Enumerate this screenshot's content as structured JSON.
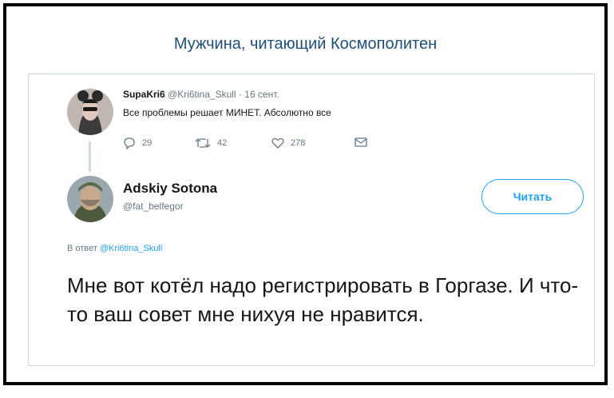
{
  "meme_title": "Мужчина, читающий Космополитен",
  "tweet_original": {
    "author_name": "SupaKri6",
    "handle": "@Kri6tina_Skull",
    "separator": "·",
    "date": "16 сент.",
    "text": "Все проблемы решает МИНЕТ. Абсолютно все",
    "replies_count": "29",
    "retweets_count": "42",
    "likes_count": "278",
    "icons": [
      "reply-icon",
      "retweet-icon",
      "like-icon",
      "message-icon"
    ]
  },
  "tweet_reply": {
    "author_name": "Adskiy Sotona",
    "handle": "@fat_belfegor",
    "follow_label": "Читать",
    "reply_prefix": "В ответ",
    "reply_handle": "@Kri6tina_Skull",
    "text": "Мне вот котёл надо регистрировать в Горгазе. И что-то ваш совет мне нихуя не нравится."
  },
  "colors": {
    "title": "#1d4f7a",
    "accent": "#1da1f2",
    "text": "#14171a",
    "muted": "#657786",
    "border": "#cfd9de"
  }
}
